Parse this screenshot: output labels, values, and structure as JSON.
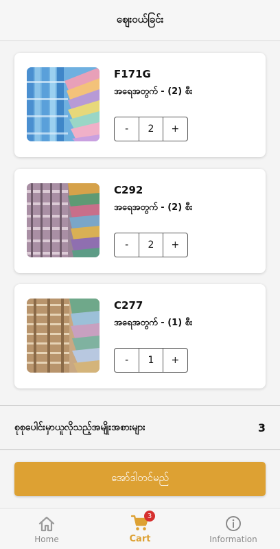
{
  "header": {
    "title": "ဈေးဝယ်ခြင်း"
  },
  "cart": {
    "items": [
      {
        "code": "F171G",
        "quantity_text": "အရေအတွက် - (2) စီး",
        "quantity": "2",
        "minus_label": "-",
        "plus_label": "+"
      },
      {
        "code": "C292",
        "quantity_text": "အရေအတွက် - (2) စီး",
        "quantity": "2",
        "minus_label": "-",
        "plus_label": "+"
      },
      {
        "code": "C277",
        "quantity_text": "အရေအတွက် - (1) စီး",
        "quantity": "1",
        "minus_label": "-",
        "plus_label": "+"
      }
    ]
  },
  "summary": {
    "total_label": "စုစုပေါင်းမှာယူလိုသည့်အမျိုးအစားများ",
    "total_count": "3"
  },
  "order_button": {
    "label": "အော်ဒါတင်မည်"
  },
  "bottom_nav": {
    "items": [
      {
        "label": "Home",
        "icon": "home-icon"
      },
      {
        "label": "Cart",
        "icon": "cart-icon",
        "badge": "3"
      },
      {
        "label": "Information",
        "icon": "info-icon"
      }
    ]
  },
  "colors": {
    "accent": "#dda133",
    "badge": "#d6302f"
  }
}
